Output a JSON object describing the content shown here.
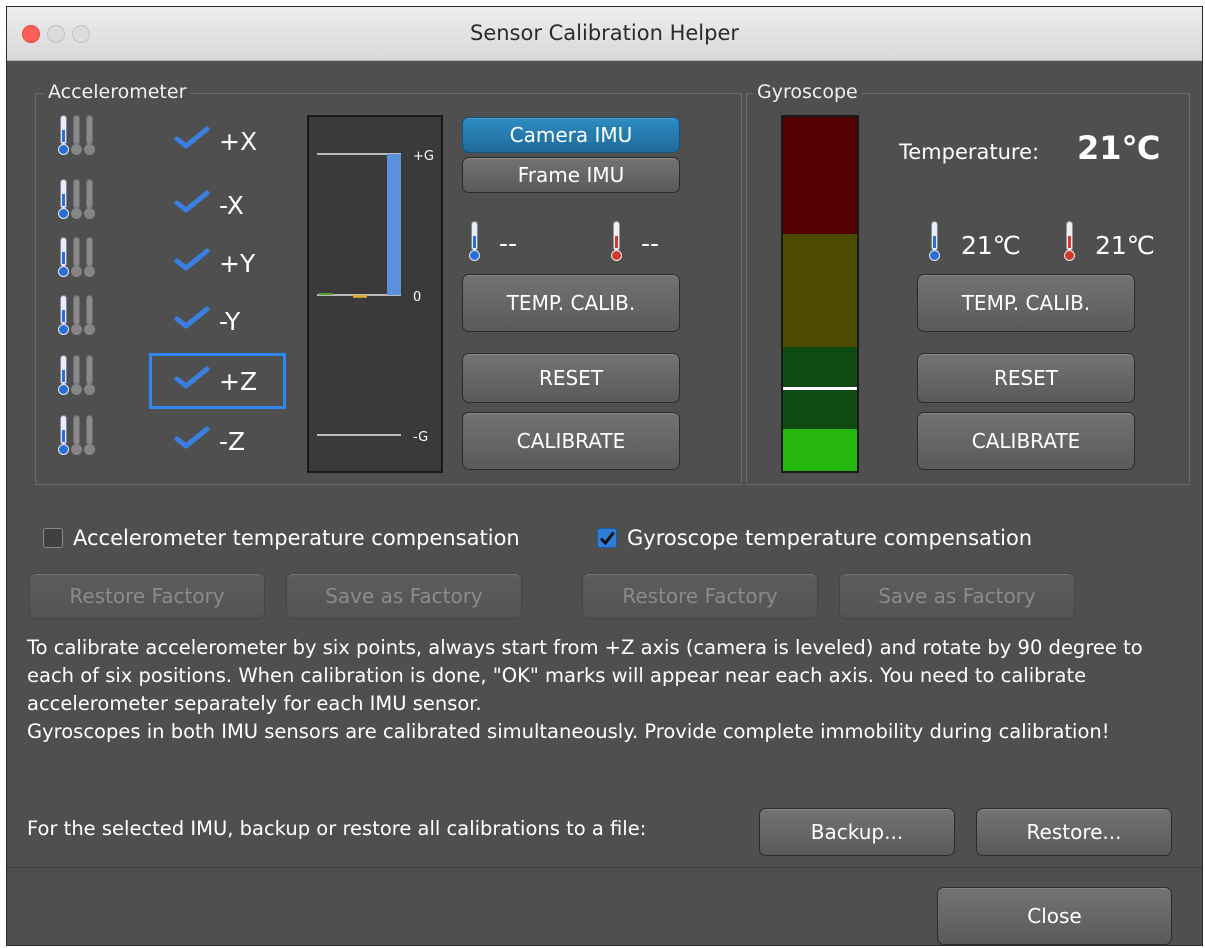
{
  "window": {
    "title": "Sensor Calibration Helper"
  },
  "accelerometer": {
    "title": "Accelerometer",
    "axes": [
      {
        "label": "+X",
        "checked": true,
        "selected": false
      },
      {
        "label": "-X",
        "checked": true,
        "selected": false
      },
      {
        "label": "+Y",
        "checked": true,
        "selected": false
      },
      {
        "label": "-Y",
        "checked": true,
        "selected": false
      },
      {
        "label": "+Z",
        "checked": true,
        "selected": true
      },
      {
        "label": "-Z",
        "checked": true,
        "selected": false
      }
    ],
    "chart": {
      "top_label": "+G",
      "zero_label": "0",
      "bottom_label": "-G",
      "z_value_fraction": 1.0,
      "x_value_fraction": 0.0,
      "y_value_fraction": -0.02,
      "colors": {
        "z": "#5b8fe0",
        "x": "#58a03a",
        "y": "#e0a82e"
      }
    },
    "imu_buttons": {
      "camera": "Camera IMU",
      "frame": "Frame IMU",
      "selected": "camera"
    },
    "temp_left": "--",
    "temp_right": "--",
    "temp_calib_label": "TEMP. CALIB.",
    "reset_label": "RESET",
    "calibrate_label": "CALIBRATE",
    "compensation_label": "Accelerometer temperature compensation",
    "compensation_checked": false
  },
  "gyroscope": {
    "title": "Gyroscope",
    "temperature_label": "Temperature:",
    "temperature_value": "21℃",
    "temp_left": "21℃",
    "temp_right": "21℃",
    "temp_calib_label": "TEMP. CALIB.",
    "reset_label": "RESET",
    "calibrate_label": "CALIBRATE",
    "gauge_level_fraction": 0.235,
    "gauge_colors": {
      "bad": "#520000",
      "warn": "#4d4b00",
      "good_dark": "#0f4a12",
      "good_bright": "#26b70f",
      "marker": "#ffffff"
    },
    "compensation_label": "Gyroscope temperature compensation",
    "compensation_checked": true
  },
  "factory_buttons": {
    "accel_restore": "Restore Factory",
    "accel_save": "Save as Factory",
    "gyro_restore": "Restore Factory",
    "gyro_save": "Save as Factory"
  },
  "info": {
    "line1": "To calibrate accelerometer by six points, always start from +Z axis (camera is leveled) and rotate by 90 degree to each of six positions. When calibration is done, \"OK\" marks will appear near each axis. You need to calibrate accelerometer separately for each IMU sensor.",
    "line2": "Gyroscopes in both IMU sensors are calibrated simultaneously. Provide complete immobility during calibration!"
  },
  "backup": {
    "label": "For the selected IMU, backup or restore all calibrations to a file:",
    "backup_button": "Backup...",
    "restore_button": "Restore..."
  },
  "footer": {
    "close_button": "Close"
  }
}
